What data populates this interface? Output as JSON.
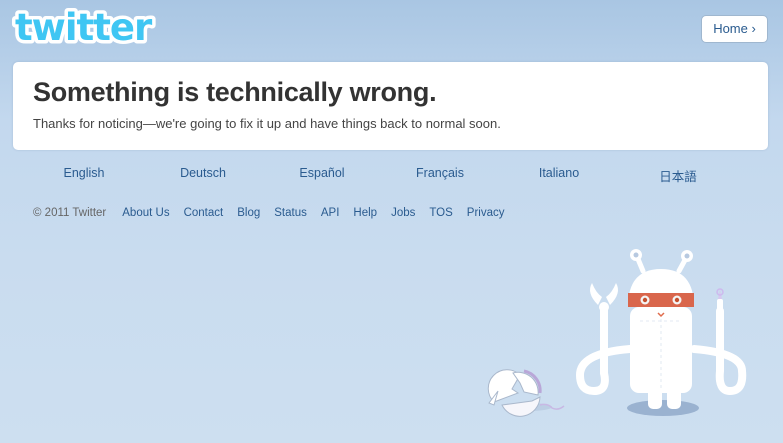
{
  "header": {
    "logo_text": "twitter",
    "home_label": "Home ›"
  },
  "error": {
    "title": "Something is technically wrong.",
    "message": "Thanks for noticing—we're going to fix it up and have things back to normal soon."
  },
  "languages": [
    "English",
    "Deutsch",
    "Español",
    "Français",
    "Italiano",
    "日本語"
  ],
  "footer": {
    "copyright": "© 2011 Twitter",
    "links": [
      "About Us",
      "Contact",
      "Blog",
      "Status",
      "API",
      "Help",
      "Jobs",
      "TOS",
      "Privacy"
    ]
  },
  "colors": {
    "link": "#2a5b8f",
    "logo": "#33ccff",
    "background": "#c0d6ed"
  },
  "illustration": {
    "icon": "robot-with-broken-ball-icon"
  }
}
